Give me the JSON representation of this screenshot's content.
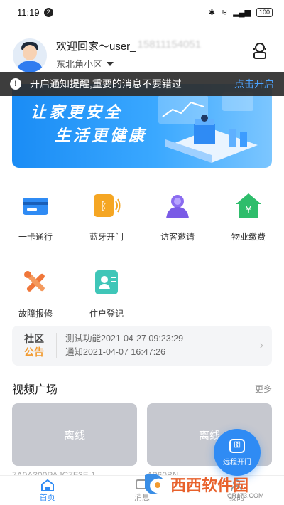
{
  "status_bar": {
    "time": "11:19",
    "notif_count": "2",
    "battery": "100"
  },
  "header": {
    "welcome": "欢迎回家～user_",
    "username_blurred": "15811154051",
    "community": "东北角小区"
  },
  "notice_bar": {
    "text": "开启通知提醒,重要的消息不要错过",
    "action": "点击开启"
  },
  "banner": {
    "line1": "让家更安全",
    "line2": "生活更健康"
  },
  "services": [
    {
      "label": "一卡通行",
      "icon": "card-icon"
    },
    {
      "label": "蓝牙开门",
      "icon": "bluetooth-door-icon"
    },
    {
      "label": "访客邀请",
      "icon": "visitor-icon"
    },
    {
      "label": "物业缴费",
      "icon": "payment-icon"
    },
    {
      "label": "故障报修",
      "icon": "repair-icon"
    },
    {
      "label": "住户登记",
      "icon": "register-icon"
    }
  ],
  "community_notice": {
    "tag_top": "社区",
    "tag_bottom": "公告",
    "items": [
      "测试功能2021-04-27 09:23:29",
      "通知2021-04-07 16:47:26"
    ]
  },
  "video_section": {
    "title": "视频广场",
    "more": "更多",
    "cards": [
      {
        "status": "离线",
        "name": "7A0A300PAJC7F3F-1"
      },
      {
        "status": "离线",
        "name": "A360BN..."
      }
    ]
  },
  "remote_button": {
    "label": "远程开门"
  },
  "tabbar": [
    {
      "label": "首页",
      "icon": "home-icon",
      "active": true
    },
    {
      "label": "消息",
      "icon": "message-icon",
      "active": false
    },
    {
      "label": "我的",
      "icon": "profile-icon",
      "active": false
    }
  ],
  "watermark": {
    "text": "西西软件园",
    "url": "CR173.COM"
  },
  "colors": {
    "accent": "#2f8bf4",
    "notice_bg": "#2d2d2d",
    "announce_orange": "#f29b30"
  }
}
